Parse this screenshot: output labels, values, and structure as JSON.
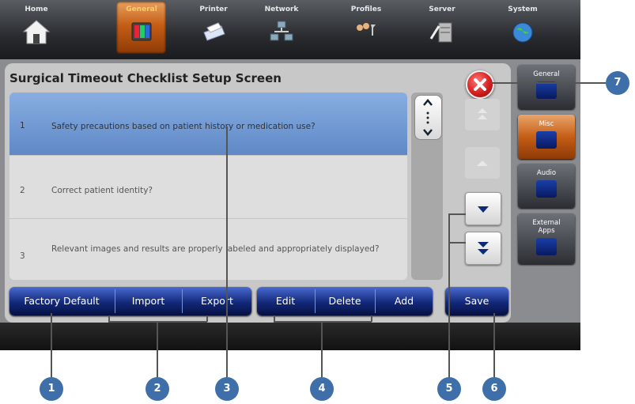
{
  "nav": {
    "tabs": [
      {
        "label": "Home",
        "icon": "home-icon"
      },
      {
        "label": "General",
        "icon": "general-icon",
        "active": true
      },
      {
        "label": "Printer",
        "icon": "printer-icon"
      },
      {
        "label": "Network",
        "icon": "network-icon"
      },
      {
        "label": "Profiles",
        "icon": "profiles-icon"
      },
      {
        "label": "Server",
        "icon": "server-icon"
      },
      {
        "label": "System",
        "icon": "system-icon"
      }
    ]
  },
  "screen": {
    "title": "Surgical Timeout Checklist Setup Screen"
  },
  "checklist": {
    "items": [
      {
        "num": "1",
        "text": "Safety precautions based on patient history or medication use?",
        "selected": true
      },
      {
        "num": "2",
        "text": "Correct patient identity?"
      },
      {
        "num": "3",
        "text": "Relevant images and results are properly labeled and appropriately displayed?"
      }
    ]
  },
  "side_tabs": [
    {
      "label": "General",
      "icon": "general-settings-icon"
    },
    {
      "label": "Misc",
      "icon": "misc-icon",
      "active": true
    },
    {
      "label": "Audio",
      "icon": "audio-icon"
    },
    {
      "label": "External Apps",
      "icon": "external-apps-icon"
    }
  ],
  "buttons": {
    "factory_default": "Factory Default",
    "import": "Import",
    "export": "Export",
    "edit": "Edit",
    "delete": "Delete",
    "add": "Add",
    "save": "Save"
  },
  "callouts": [
    "1",
    "2",
    "3",
    "4",
    "5",
    "6",
    "7"
  ],
  "colors": {
    "accent_orange": "#c55e16",
    "button_blue": "#12287a",
    "selection_blue": "#6f96d2",
    "callout_blue": "#3e6fa8",
    "close_red": "#d42020"
  }
}
